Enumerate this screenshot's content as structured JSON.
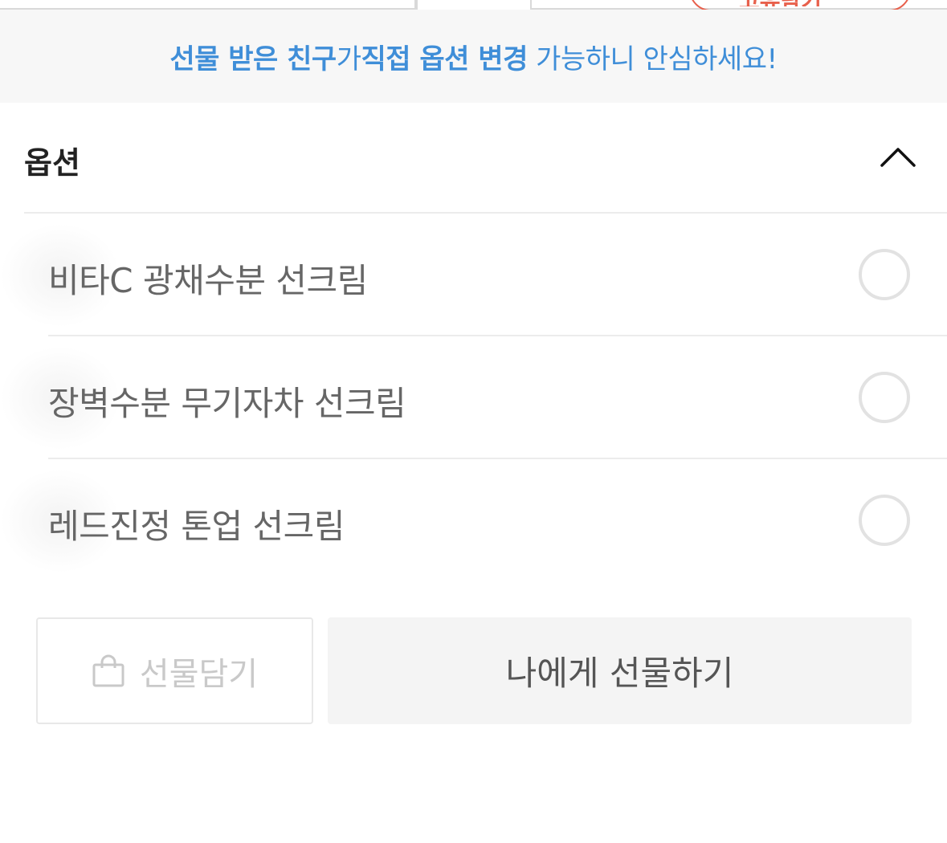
{
  "notice": {
    "part1": "선물 받은 친구",
    "part2": "가 ",
    "part3": "직접 옵션 변경",
    "part4": " 가능하니 안심하세요!"
  },
  "tabs": {
    "partial_label": "고유담기"
  },
  "options": {
    "title": "옵션",
    "items": [
      {
        "label": "비타C 광채수분 선크림",
        "selected": false
      },
      {
        "label": "장벽수분 무기자차 선크림",
        "selected": false
      },
      {
        "label": "레드진정 톤업 선크림",
        "selected": false
      }
    ]
  },
  "buttons": {
    "cart_label": "선물담기",
    "self_gift_label": "나에게 선물하기"
  },
  "colors": {
    "notice_text": "#3f8ed8",
    "notice_bg": "#f7f7f7",
    "accent_red": "#e8604c"
  }
}
